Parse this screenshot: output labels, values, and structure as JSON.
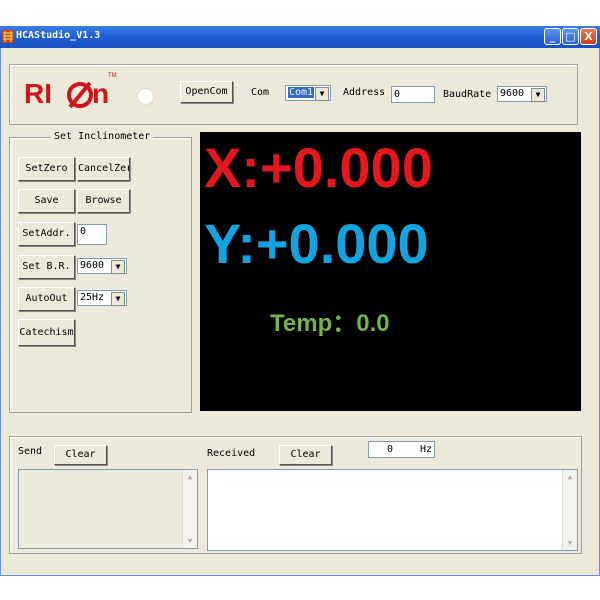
{
  "window": {
    "title": "HCAStudio_V1.3",
    "minimize_glyph": "_",
    "maximize_glyph": "□",
    "close_glyph": "X"
  },
  "connection": {
    "logo_text": "RI",
    "logo_text_2": "n",
    "logo_tm": "TM",
    "open_com_label": "OpenCom",
    "com_label": "Com",
    "com_value": "Com1",
    "address_label": "Address",
    "address_value": "0",
    "baudrate_label": "BaudRate",
    "baudrate_value": "9600"
  },
  "inclinometer": {
    "group_title": "Set Inclinometer",
    "set_zero_label": "SetZero",
    "cancel_zero_label": "CancelZer",
    "save_label": "Save",
    "browse_label": "Browse",
    "set_addr_label": "SetAddr.",
    "set_addr_value": "0",
    "set_br_label": "Set B.R.",
    "set_br_value": "9600",
    "auto_out_label": "AutoOut",
    "auto_out_value": "25Hz",
    "catechism_label": "Catechism"
  },
  "display": {
    "x_reading": "X:+0.000",
    "y_reading": "Y:+0.000",
    "temp_reading": "Temp：0.0"
  },
  "log": {
    "send_label": "Send",
    "send_clear_label": "Clear",
    "received_label": "Received",
    "received_clear_label": "Clear",
    "rate_value": "0",
    "rate_unit": "Hz"
  },
  "colors": {
    "x_color": "#e4161e",
    "y_color": "#12a4e0",
    "temp_color": "#71b646",
    "logo_red": "#d4121a",
    "titlebar_blue": "#1f5fd6"
  }
}
